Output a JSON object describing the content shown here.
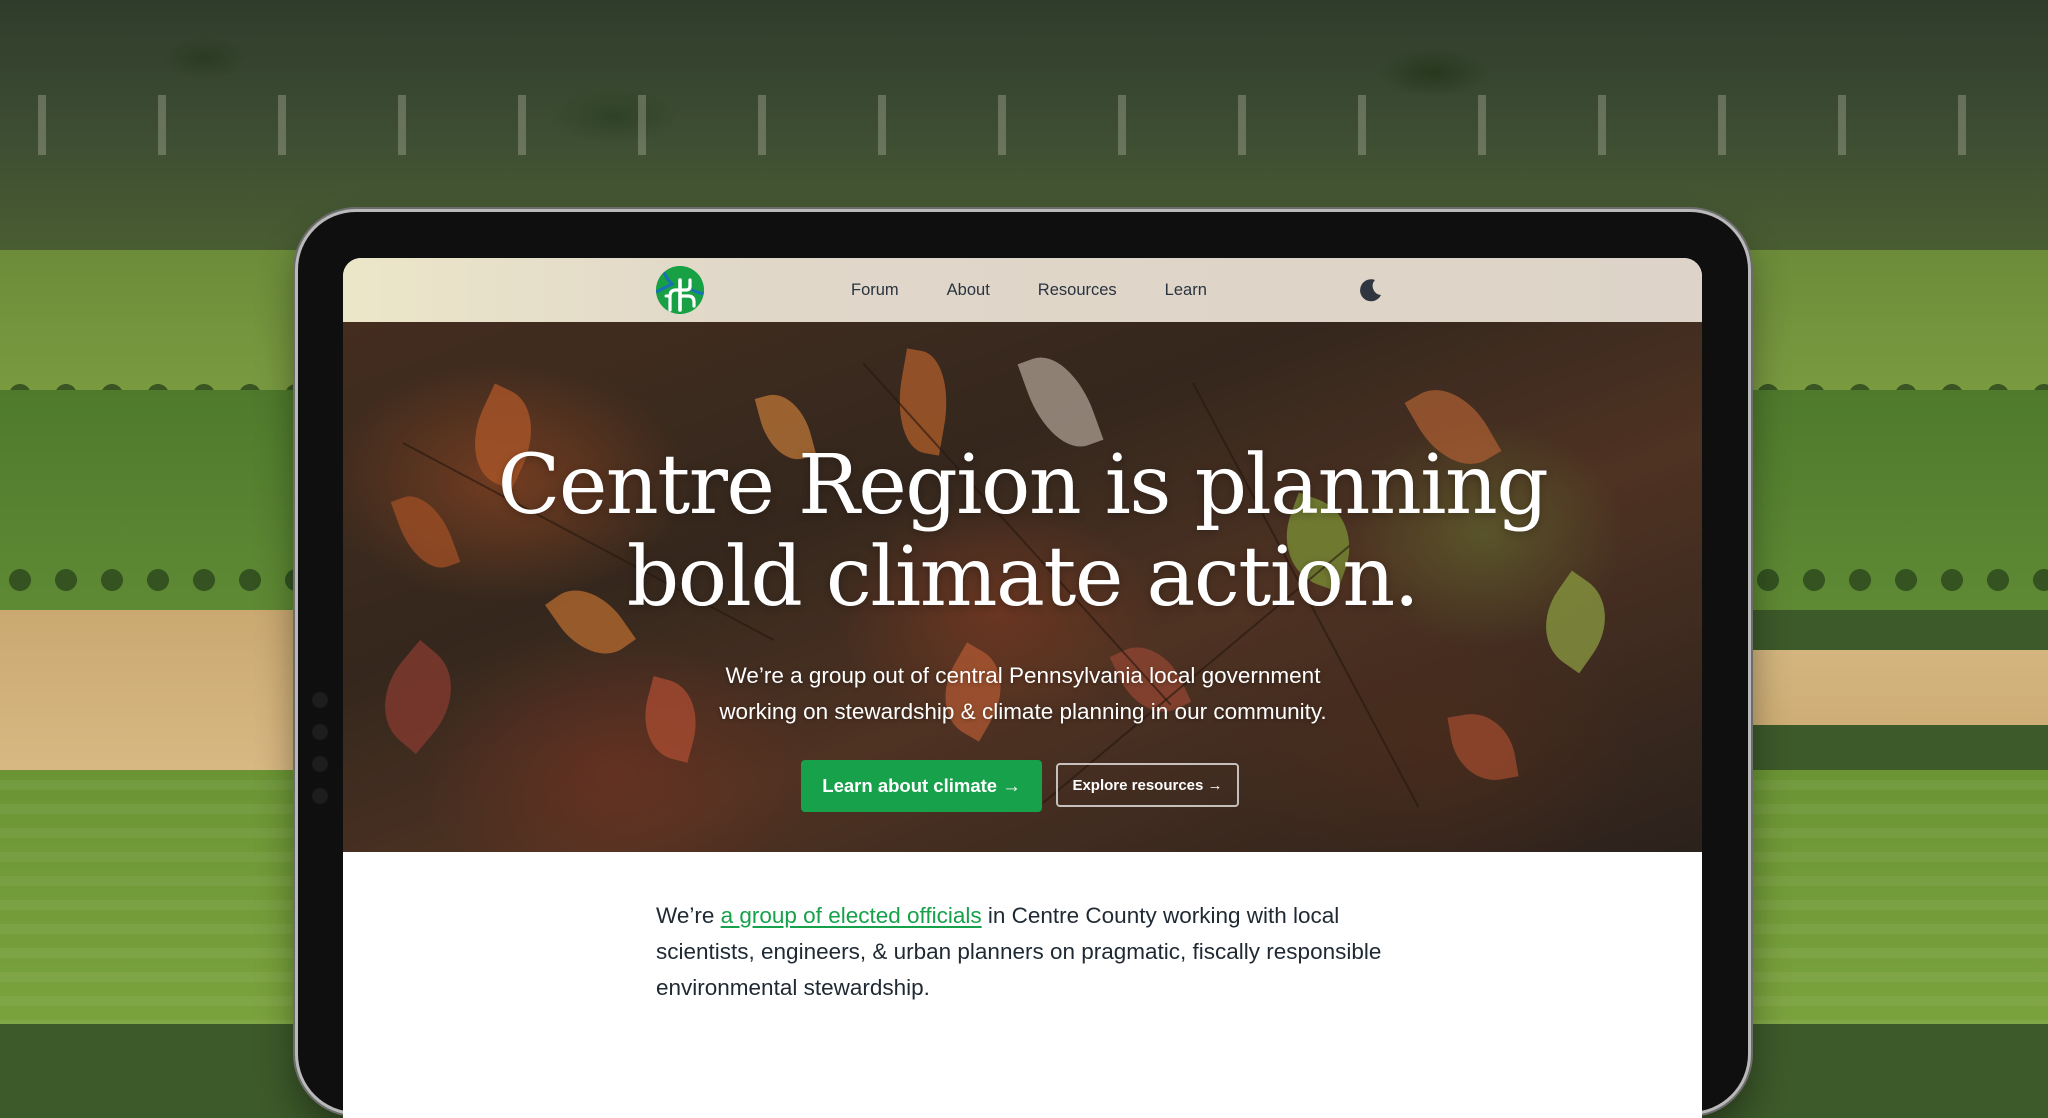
{
  "nav": {
    "links": [
      "Forum",
      "About",
      "Resources",
      "Learn"
    ],
    "theme_toggle_icon": "moon-icon",
    "logo_icon": "tree-logo-icon"
  },
  "hero": {
    "title_line1": "Centre Region is planning",
    "title_line2": "bold climate action.",
    "subtitle_line1": "We’re a group out of central Pennsylvania local government",
    "subtitle_line2": "working on stewardship & climate planning in our community.",
    "primary_cta": "Learn about climate →",
    "secondary_cta": "Explore resources →"
  },
  "intro": {
    "prefix": "We’re ",
    "link_text": "a group of elected officials",
    "suffix": " in Centre County working with local scientists, engineers, & urban planners on pragmatic, fiscally responsible environmental stewardship."
  },
  "colors": {
    "accent": "#16a14a",
    "navbar": "#ddd3c8",
    "text": "#1f2933",
    "device_bezel": "#0f0f0f"
  }
}
